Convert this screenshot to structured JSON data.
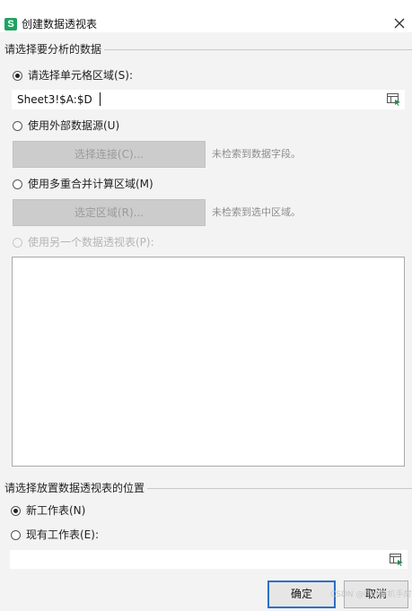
{
  "window": {
    "app_logo_letter": "S",
    "title": "创建数据透视表",
    "close_glyph": "✕"
  },
  "section_source": {
    "header": "请选择要分析的数据",
    "option_range": {
      "label": "请选择单元格区域(S):",
      "checked": true,
      "input_value": "Sheet3!$A:$D"
    },
    "option_external": {
      "label": "使用外部数据源(U)",
      "checked": false,
      "button_label": "选择连接(C)...",
      "hint": "未检索到数据字段。"
    },
    "option_consolidate": {
      "label": "使用多重合并计算区域(M)",
      "checked": false,
      "button_label": "选定区域(R)...",
      "hint": "未检索到选中区域。"
    },
    "option_other_pivot": {
      "label": "使用另一个数据透视表(P):",
      "checked": false,
      "disabled": true
    }
  },
  "section_location": {
    "header": "请选择放置数据透视表的位置",
    "option_new_sheet": {
      "label": "新工作表(N)",
      "checked": true
    },
    "option_existing_sheet": {
      "label": "现有工作表(E):",
      "checked": false,
      "input_value": ""
    }
  },
  "buttons": {
    "ok": "确定",
    "cancel": "取消"
  },
  "watermark": "CSDN @IT计算机手房",
  "colors": {
    "app_logo": "#1fa35f",
    "ok_border": "#2f6fc6",
    "dialog_bg": "#f3f3f3"
  },
  "icons": {
    "close": "close-icon",
    "range_picker": "range-picker-icon",
    "app": "wps-spreadsheet-logo-icon"
  }
}
